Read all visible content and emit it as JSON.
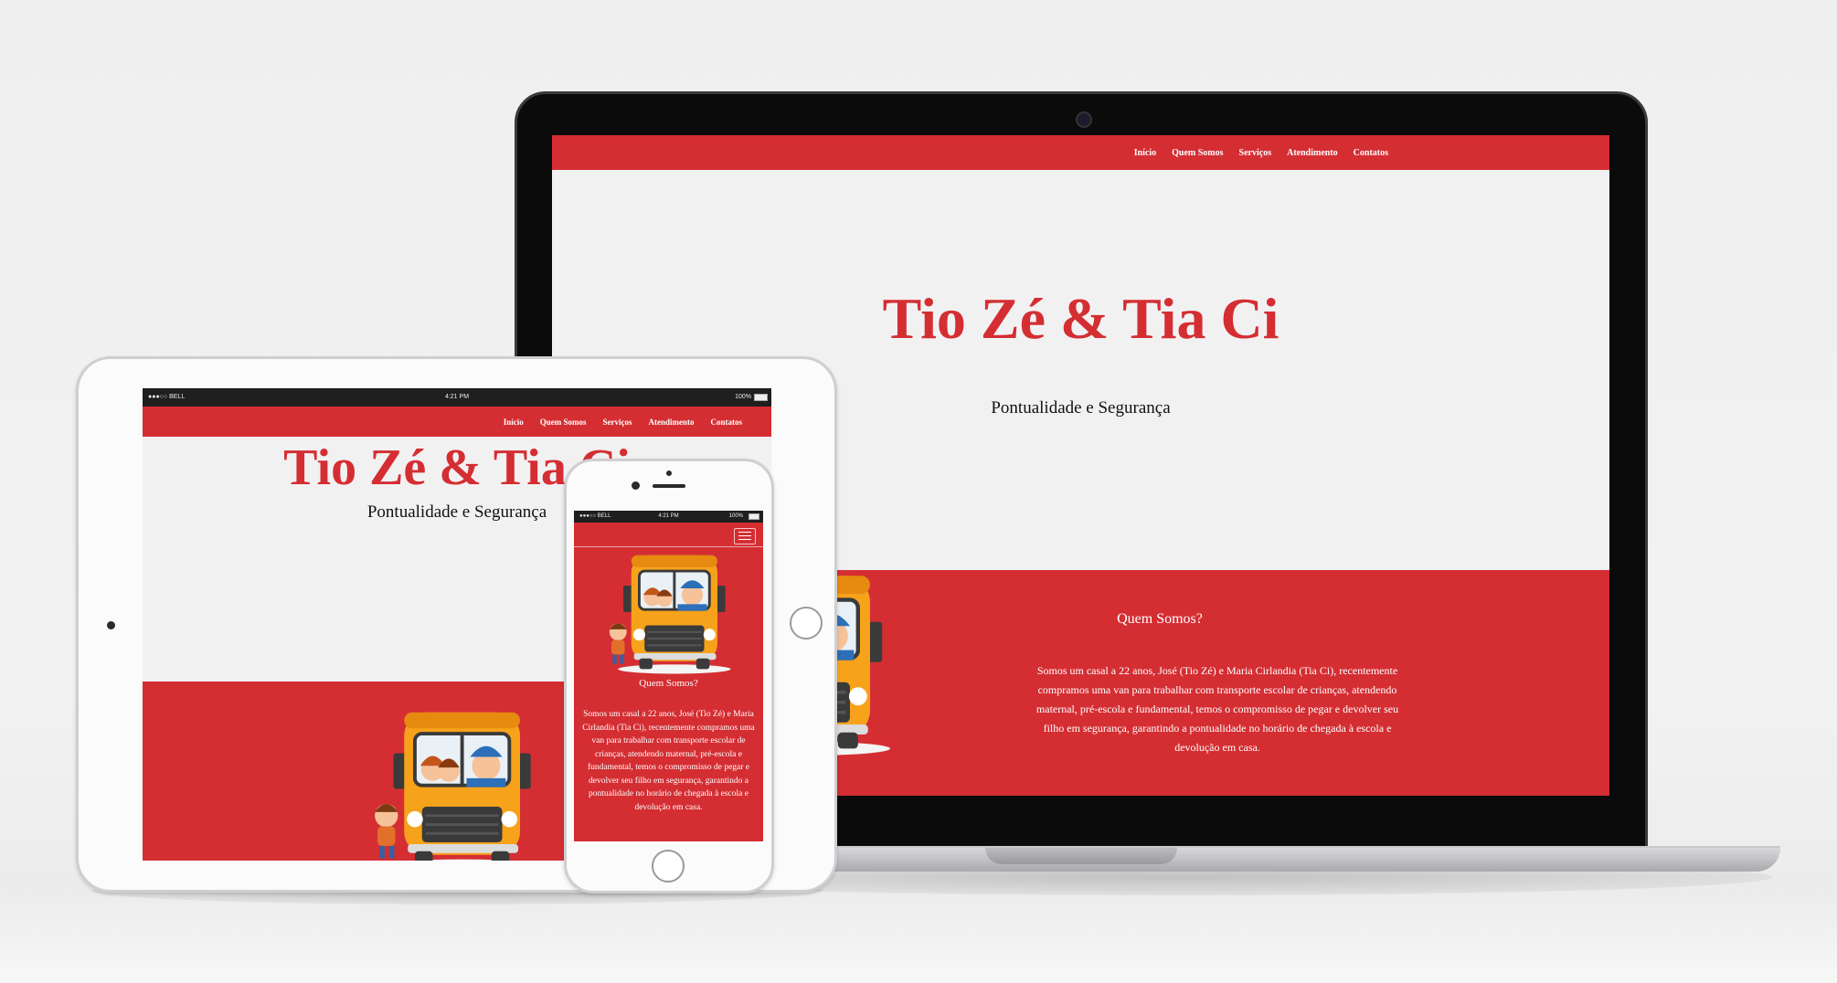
{
  "brand_color": "#d42e33",
  "site": {
    "nav": [
      "Início",
      "Quem Somos",
      "Serviços",
      "Atendimento",
      "Contatos"
    ],
    "title": "Tio Zé & Tia Ci",
    "subtitle": "Pontualidade e Segurança",
    "about_title": "Quem Somos?",
    "about_text": "Somos um casal a 22 anos, José (Tio Zé) e Maria Cirlandia (Tia Ci), recentemente compramos uma van para trabalhar com transporte escolar de crianças, atendendo maternal, pré-escola e fundamental, temos o compromisso de pegar e devolver seu filho em segurança, garantindo a pontualidade no horário de chegada à escola e devolução em casa."
  },
  "statusbar": {
    "carrier": "●●●○○ BELL",
    "time": "4:21 PM",
    "battery": "100%"
  },
  "icons": {
    "menu": "hamburger-menu-icon",
    "bus": "school-bus-illustration",
    "wifi": "wifi-icon",
    "battery": "battery-icon"
  }
}
